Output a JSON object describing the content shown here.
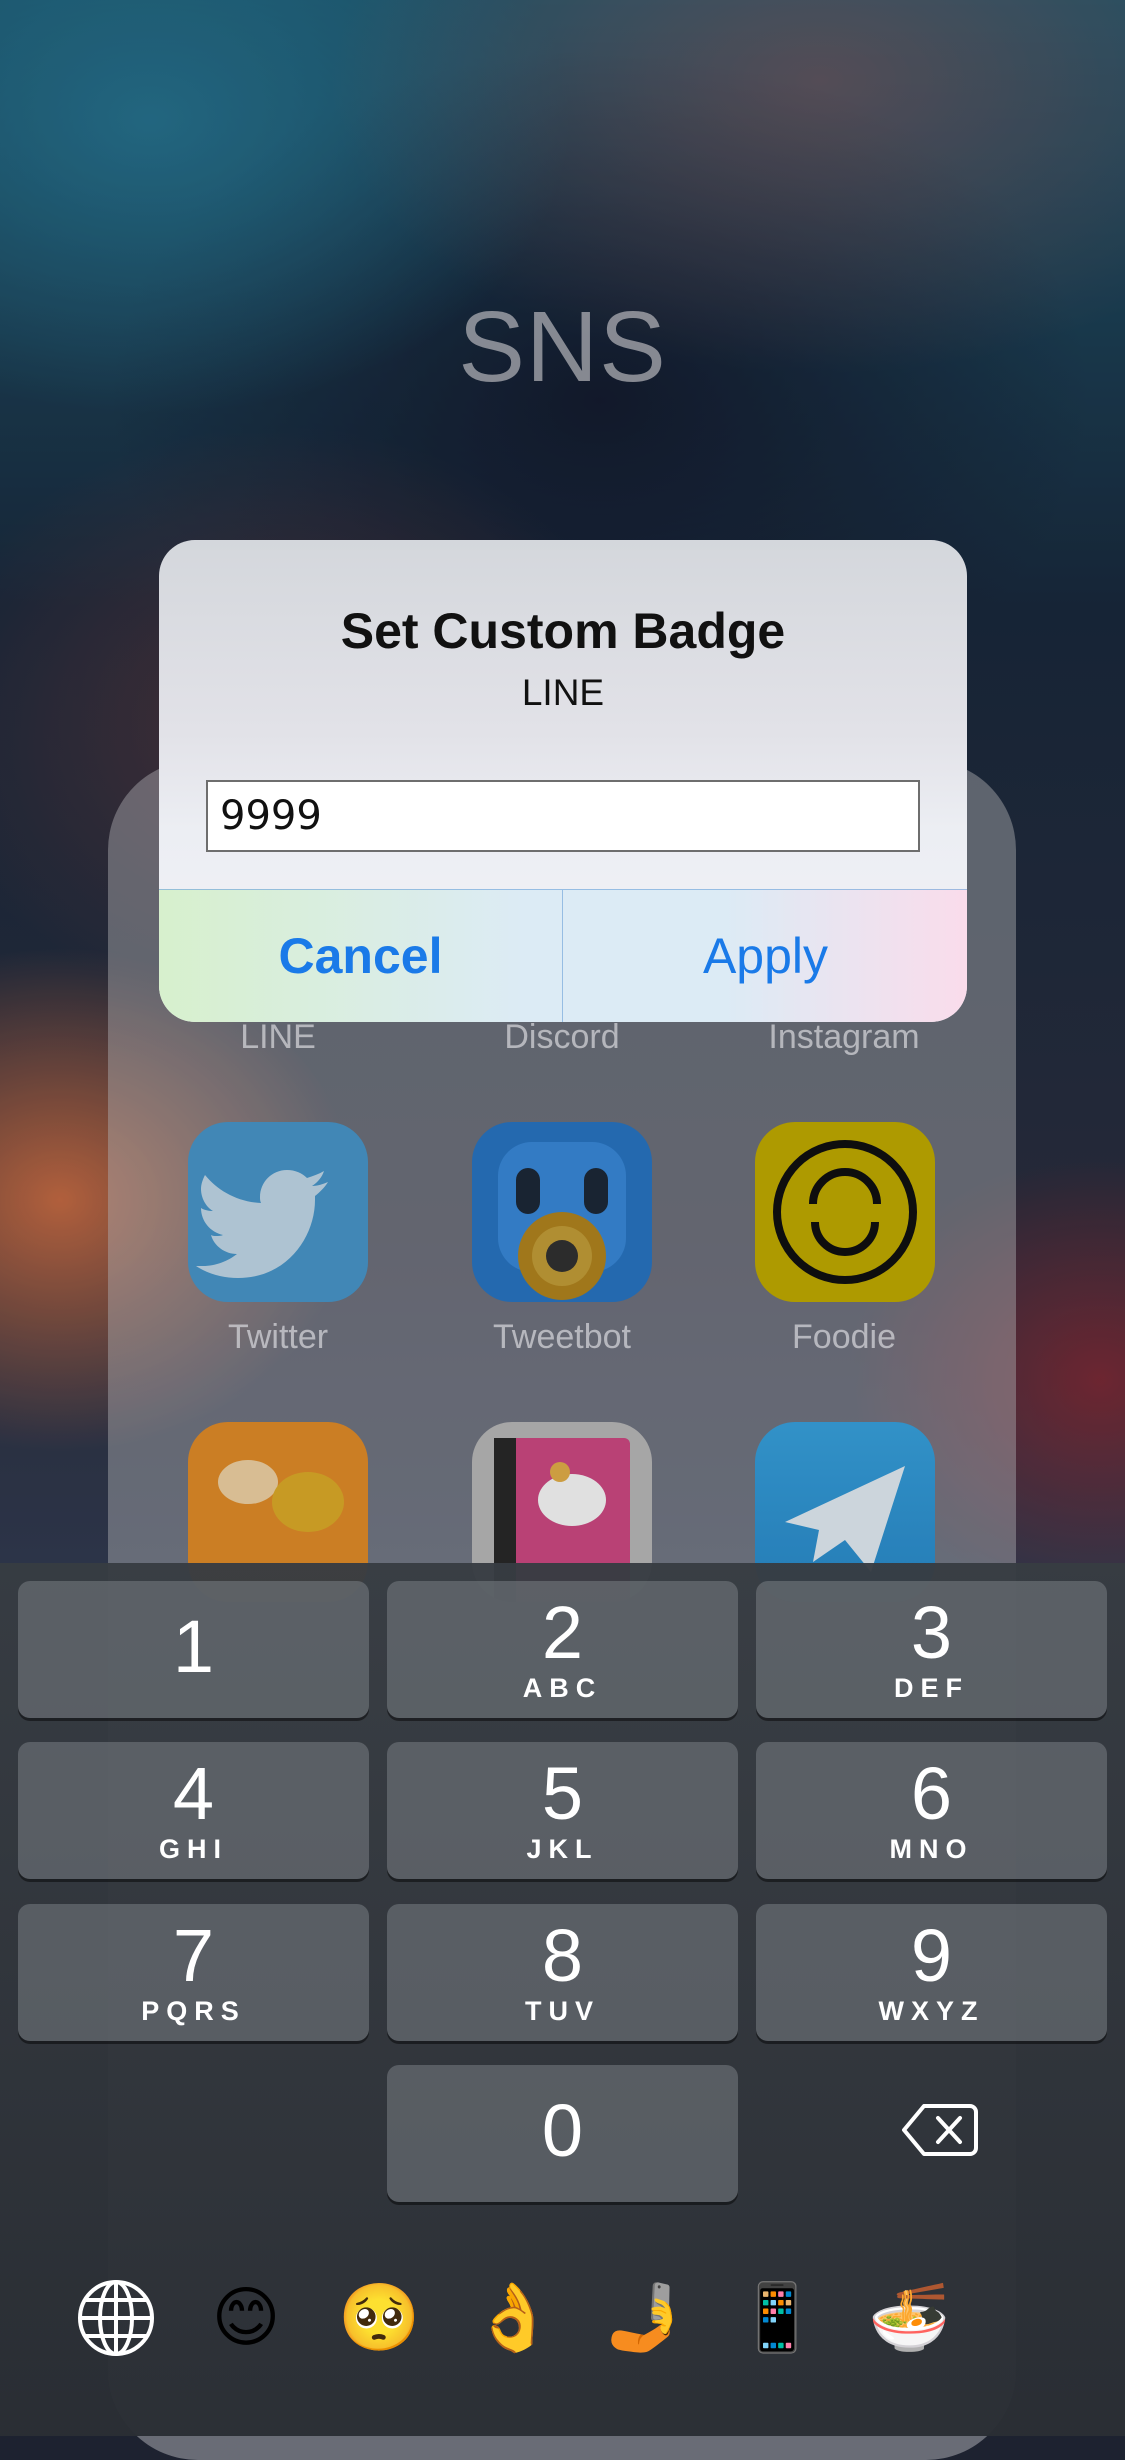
{
  "folder": {
    "title": "SNS",
    "row1_labels": [
      "LINE",
      "Discord",
      "Instagram"
    ],
    "row2_labels": [
      "Twitter",
      "Tweetbot",
      "Foodie"
    ]
  },
  "alert": {
    "title": "Set Custom Badge",
    "message": "LINE",
    "input_value": "9999",
    "cancel_label": "Cancel",
    "apply_label": "Apply"
  },
  "keypad": {
    "keys": [
      {
        "digit": "1",
        "letters": ""
      },
      {
        "digit": "2",
        "letters": "ABC"
      },
      {
        "digit": "3",
        "letters": "DEF"
      },
      {
        "digit": "4",
        "letters": "GHI"
      },
      {
        "digit": "5",
        "letters": "JKL"
      },
      {
        "digit": "6",
        "letters": "MNO"
      },
      {
        "digit": "7",
        "letters": "PQRS"
      },
      {
        "digit": "8",
        "letters": "TUV"
      },
      {
        "digit": "9",
        "letters": "WXYZ"
      },
      {
        "digit": "0",
        "letters": ""
      }
    ],
    "delete_icon": "backspace-icon"
  },
  "emoji_bar": {
    "globe_icon": "globe-icon",
    "emojis": [
      "😊",
      "🥺",
      "👌",
      "🤳",
      "📱",
      "🍜"
    ]
  }
}
